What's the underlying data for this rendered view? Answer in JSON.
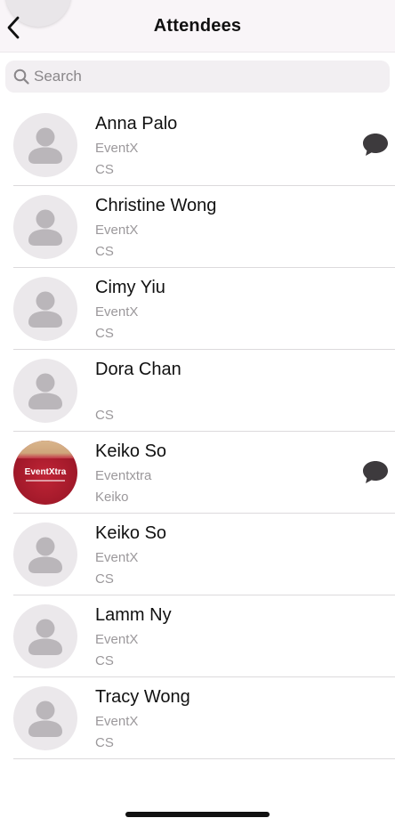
{
  "header": {
    "title": "Attendees",
    "back_icon": "chevron-left-icon"
  },
  "search": {
    "placeholder": "Search",
    "value": "",
    "icon": "search-icon"
  },
  "attendees": [
    {
      "name": "Anna Palo",
      "company": "EventX",
      "position": "CS",
      "avatar": "default",
      "chat": true
    },
    {
      "name": "Christine Wong",
      "company": "EventX",
      "position": "CS",
      "avatar": "default",
      "chat": false
    },
    {
      "name": "Cimy Yiu",
      "company": "EventX",
      "position": "CS",
      "avatar": "default",
      "chat": false
    },
    {
      "name": "Dora Chan",
      "company": "",
      "position": "CS",
      "avatar": "default",
      "chat": false
    },
    {
      "name": "Keiko So",
      "company": "Eventxtra",
      "position": "Keiko",
      "avatar": "photo",
      "chat": true,
      "logo_text": "EventXtra"
    },
    {
      "name": "Keiko So",
      "company": "EventX",
      "position": "CS",
      "avatar": "default",
      "chat": false
    },
    {
      "name": "Lamm Ny",
      "company": "EventX",
      "position": "CS",
      "avatar": "default",
      "chat": false
    },
    {
      "name": "Tracy Wong",
      "company": "EventX",
      "position": "CS",
      "avatar": "default",
      "chat": false
    }
  ],
  "colors": {
    "header_bg": "#f9f5f8",
    "avatar_bg": "#ebe8eb",
    "avatar_glyph": "#bab6ba",
    "secondary_text": "#9b989b",
    "chat_icon": "#3d3a3d"
  }
}
